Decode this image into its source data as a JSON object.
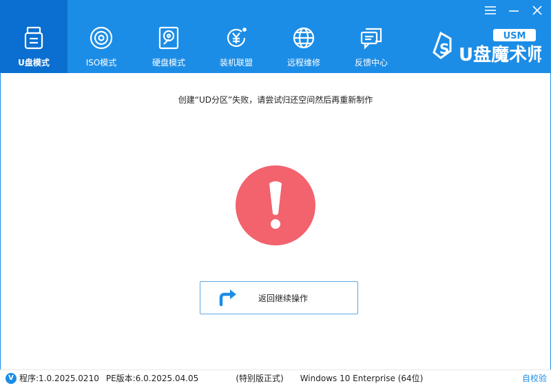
{
  "nav": {
    "items": [
      {
        "label": "U盘模式",
        "icon": "usb-drive-icon",
        "active": true
      },
      {
        "label": "ISO模式",
        "icon": "disc-icon",
        "active": false
      },
      {
        "label": "硬盘模式",
        "icon": "hard-disk-icon",
        "active": false
      },
      {
        "label": "装机联盟",
        "icon": "yen-coin-icon",
        "active": false
      },
      {
        "label": "远程维修",
        "icon": "globe-icon",
        "active": false
      },
      {
        "label": "反馈中心",
        "icon": "chat-bubble-icon",
        "active": false
      }
    ]
  },
  "logo": {
    "badge": "USM",
    "brand": "U盘魔术师"
  },
  "message": "创建“UD分区”失败，请尝试归还空间然后再重新制作",
  "return_button": {
    "label": "返回继续操作"
  },
  "status": {
    "badge": "V",
    "program": "程序:1.0.2025.0210",
    "pe": "PE版本:6.0.2025.04.05",
    "edition": "(特别版正式)",
    "os": "Windows 10 Enterprise (64位)",
    "self_check": "自校验"
  },
  "colors": {
    "accent": "#1c8de6",
    "active_tab": "#0a6fd0",
    "alert": "#f2636e"
  }
}
